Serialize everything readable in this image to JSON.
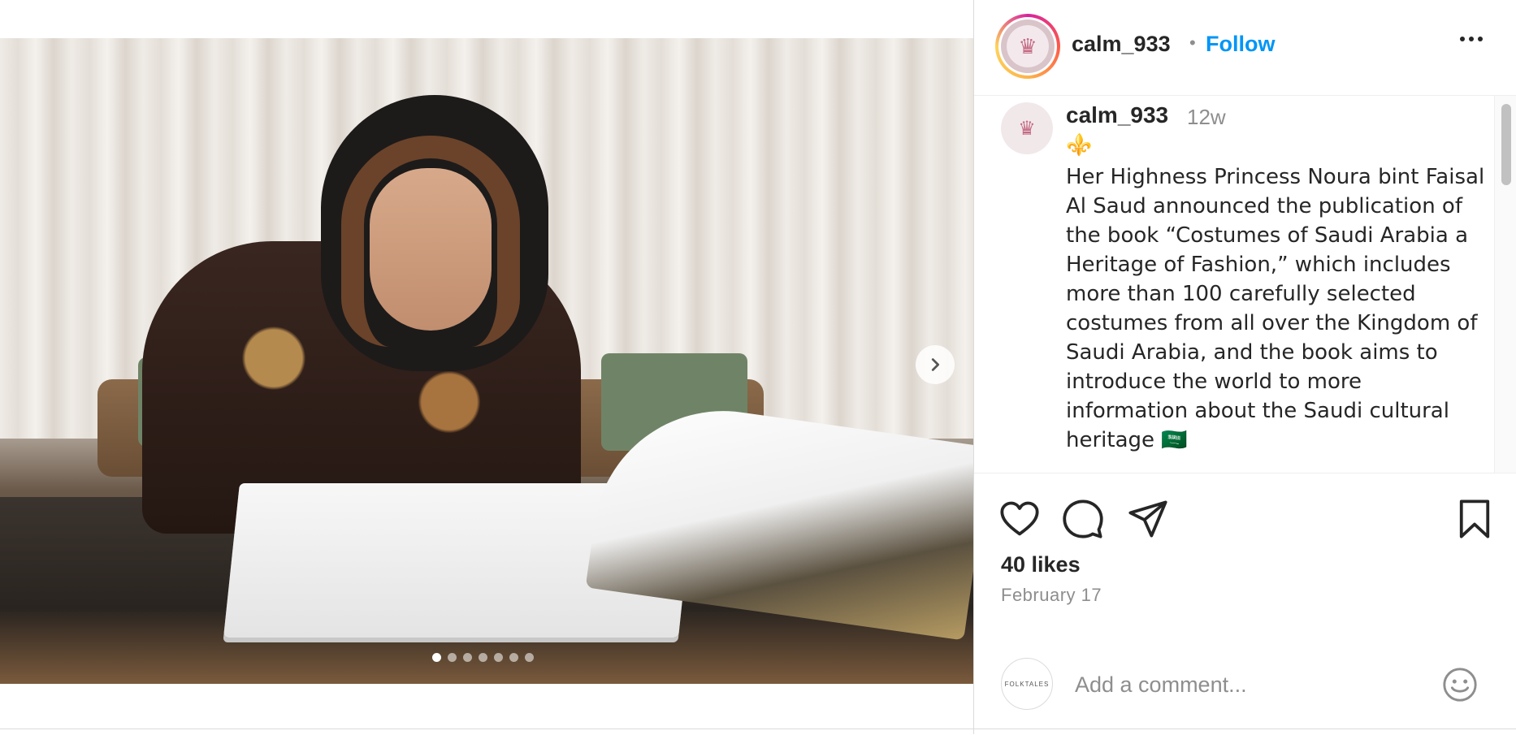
{
  "post": {
    "username": "calm_933",
    "follow_label": "Follow",
    "separator": "•",
    "more_icon": "more-horizontal-icon"
  },
  "media": {
    "carousel_dots_count": 7,
    "active_dot_index": 0,
    "next_icon": "chevron-right-icon"
  },
  "caption": {
    "username": "calm_933",
    "time": "12w",
    "emoji": "⚜️",
    "text": "Her Highness Princess Noura bint Faisal Al Saud announced the publication of the book “Costumes of Saudi Arabia a Heritage of Fashion,” which includes more than 100 carefully selected costumes from all over the Kingdom of Saudi Arabia, and the book aims to introduce the world to more information about the Saudi cultural heritage 🇸🇦"
  },
  "actions": {
    "like_icon": "heart-icon",
    "comment_icon": "comment-icon",
    "share_icon": "send-icon",
    "save_icon": "bookmark-icon",
    "likes": "40 likes",
    "date": "February 17"
  },
  "comment": {
    "avatar_text": "FOLKTALES",
    "placeholder": "Add a comment...",
    "emoji_icon": "smiley-icon"
  },
  "colors": {
    "link": "#0095f6",
    "secondary_text": "#8e8e8e",
    "primary_text": "#262626"
  }
}
